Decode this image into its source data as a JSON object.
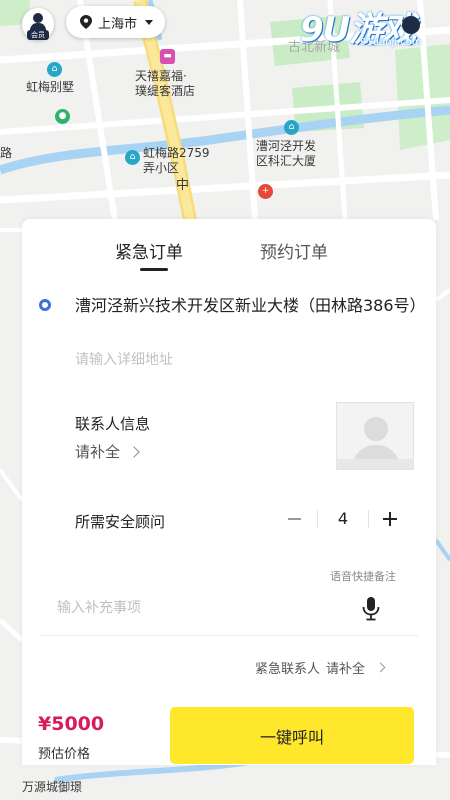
{
  "top_bar": {
    "member_badge": "会员",
    "city": "上海市"
  },
  "watermark": {
    "brand": "9U游戏",
    "site": "91danji.com"
  },
  "map": {
    "labels": {
      "yanhong": "虹梅别墅",
      "yanhong_lane": "虹梅路2759",
      "yanhong_lane2": "弄小区",
      "hotel1": "天禧嘉福·",
      "hotel2": "璞缇客酒店",
      "caohejing1": "漕河泾开发",
      "caohejing2": "区科汇大厦",
      "gubei": "古北新城",
      "road_zhong": "中",
      "road_lu": "路",
      "bottom_left": "万源城御璟"
    }
  },
  "tabs": {
    "urgent": "紧急订单",
    "scheduled": "预约订单"
  },
  "address": {
    "text": "漕河泾新兴技术开发区新业大楼（田林路386号）",
    "detail_placeholder": "请输入详细地址"
  },
  "contact": {
    "title": "联系人信息",
    "action": "请补全"
  },
  "advisor": {
    "label": "所需安全顾问",
    "count": "4"
  },
  "notes": {
    "voice_hint": "语音快捷备注",
    "placeholder": "输入补充事项"
  },
  "emergency": {
    "label": "紧急联系人",
    "action": "请补全"
  },
  "footer": {
    "price": "¥5000",
    "price_caption": "预估价格",
    "call_button": "一键呼叫"
  },
  "colors": {
    "accent_yellow": "#ffe82c",
    "price_pink": "#d81b5f",
    "location_blue": "#3f6fd8"
  }
}
